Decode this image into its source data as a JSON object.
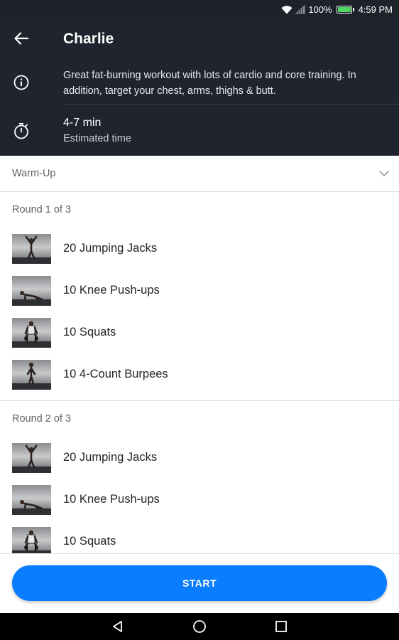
{
  "status_bar": {
    "battery_percent": "100%",
    "time": "4:59 PM",
    "battery_level": 1.0,
    "icons": [
      "wifi-icon",
      "signal-icon",
      "battery-icon"
    ]
  },
  "header": {
    "title": "Charlie",
    "description": "Great fat-burning workout with lots of cardio and core training. In addition, target your chest, arms, thighs & butt.",
    "time_value": "4-7 min",
    "time_label": "Estimated time",
    "background_color": "#20242e"
  },
  "warmup": {
    "label": "Warm-Up"
  },
  "rounds": [
    {
      "title": "Round 1 of 3",
      "exercises": [
        {
          "name": "20 Jumping Jacks"
        },
        {
          "name": "10 Knee Push-ups"
        },
        {
          "name": "10 Squats"
        },
        {
          "name": "10 4-Count Burpees"
        }
      ]
    },
    {
      "title": "Round 2 of 3",
      "exercises": [
        {
          "name": "20 Jumping Jacks"
        },
        {
          "name": "10 Knee Push-ups"
        },
        {
          "name": "10 Squats"
        }
      ]
    }
  ],
  "start_button": {
    "label": "START",
    "color": "#0a7cff"
  },
  "nav_bar": {
    "icons": [
      "back-nav-icon",
      "home-nav-icon",
      "recents-nav-icon"
    ]
  }
}
